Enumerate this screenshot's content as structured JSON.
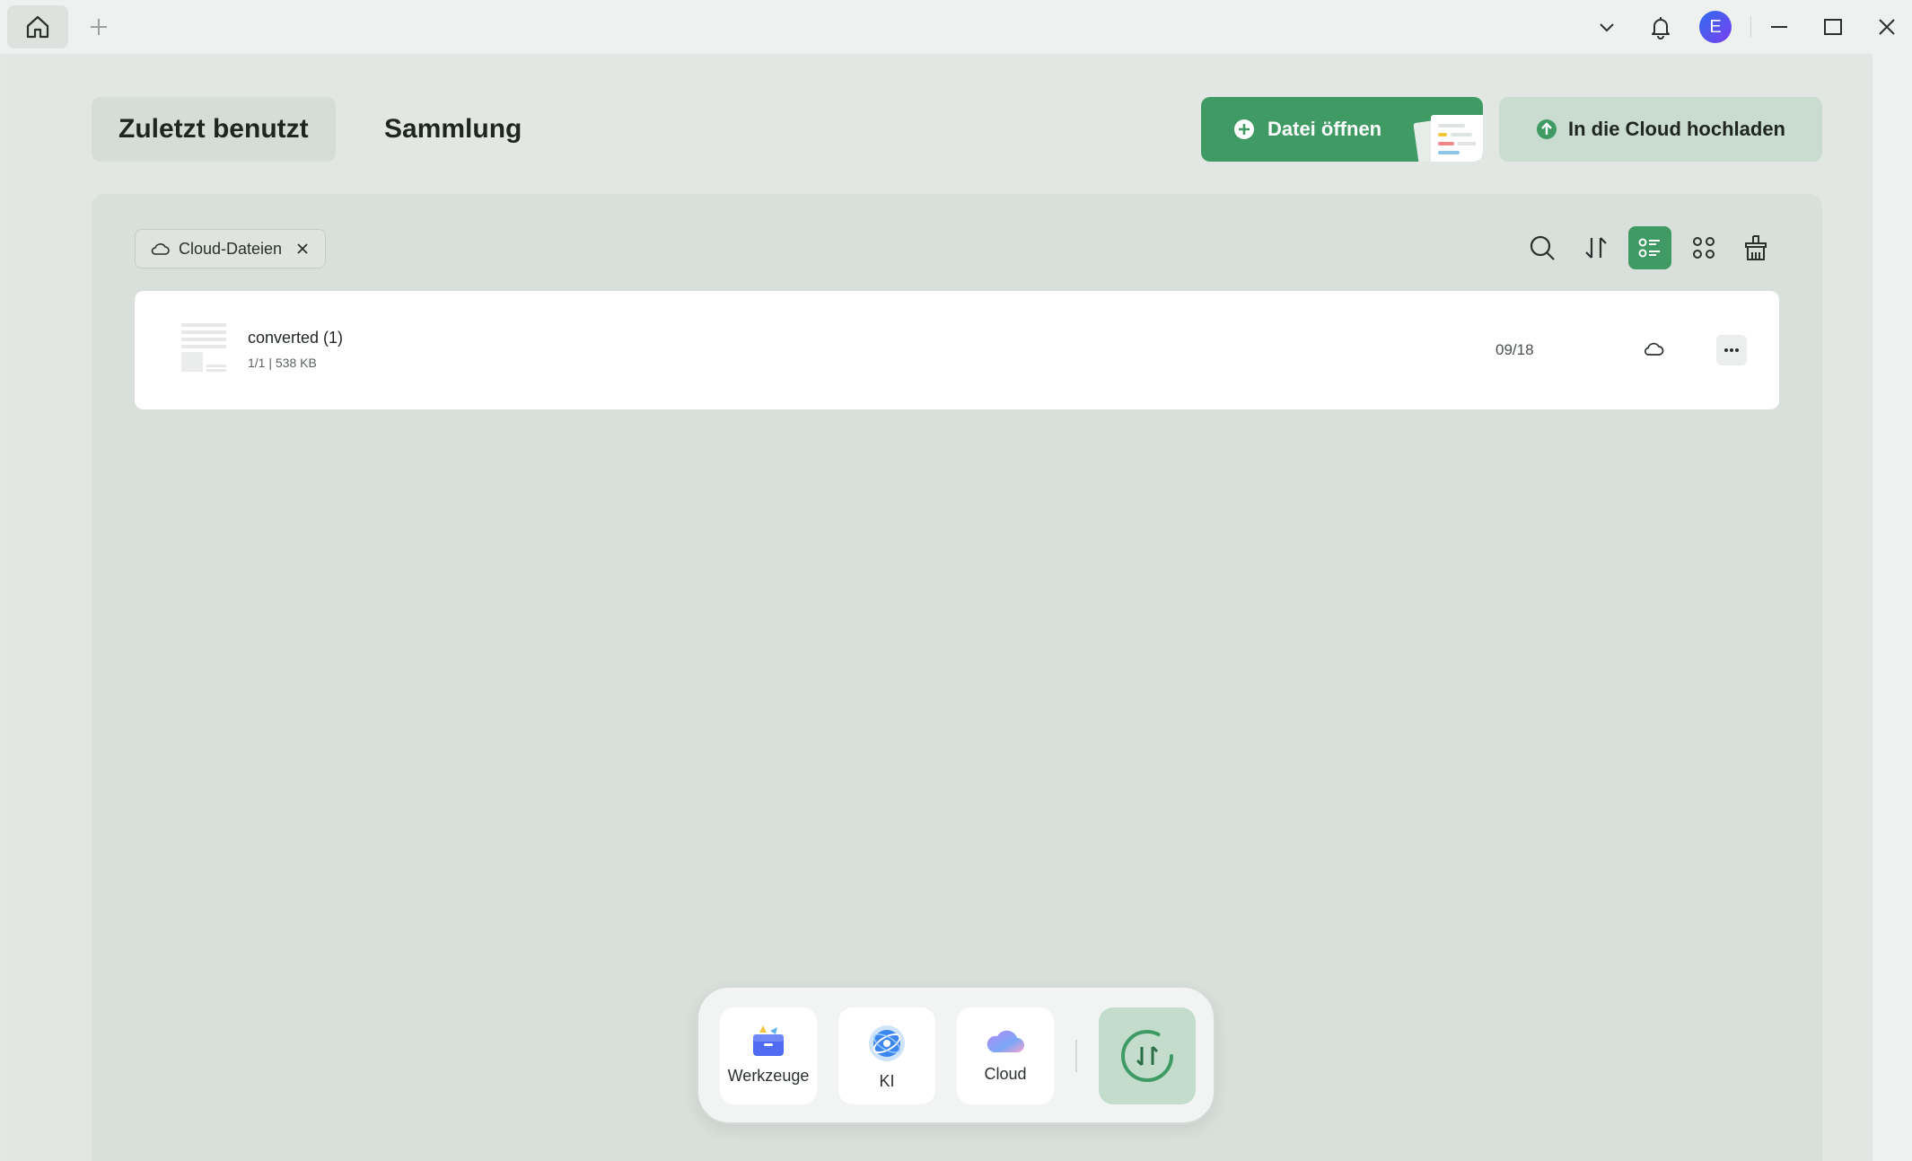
{
  "titlebar": {
    "home_icon": "home-icon",
    "new_tab_icon": "plus-icon",
    "dropdown_icon": "chevron-down-icon",
    "notification_icon": "bell-icon",
    "avatar_letter": "E",
    "minimize_icon": "minimize-icon",
    "maximize_icon": "maximize-icon",
    "close_icon": "close-icon"
  },
  "tabs": {
    "recent": "Zuletzt benutzt",
    "collection": "Sammlung"
  },
  "actions": {
    "open_file": "Datei öffnen",
    "upload_cloud": "In die Cloud hochladen"
  },
  "filter": {
    "chip_label": "Cloud-Dateien"
  },
  "toolbar": {
    "icons": [
      "search-icon",
      "sort-icon",
      "list-view-icon",
      "grid-view-icon",
      "clean-icon"
    ],
    "active_view": "list"
  },
  "files": [
    {
      "name": "converted (1)",
      "meta": "1/1 | 538 KB",
      "date": "09/18",
      "location_icon": "cloud-icon"
    }
  ],
  "dock": {
    "items": [
      {
        "label": "Werkzeuge",
        "icon": "toolbox-icon"
      },
      {
        "label": "KI",
        "icon": "ai-icon"
      },
      {
        "label": "Cloud",
        "icon": "cloud-icon"
      }
    ],
    "convert_icon": "convert-icon"
  },
  "colors": {
    "accent": "#3f9a63",
    "accent_light": "#c9dccf",
    "panel": "#d9dfdb",
    "background": "#e3e7e4"
  }
}
